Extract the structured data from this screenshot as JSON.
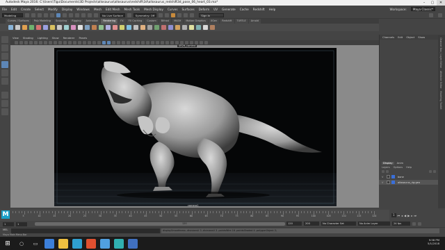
{
  "window": {
    "title": "Autodesk Maya 2016: C:\\Users\\Tigu\\Documents\\3D Projects\\allosaurus\\allosaurus\\redshift\\3d\\allosaurus_redshift3d_pose_06_heart_03.ma*",
    "controls": [
      "–",
      "▢",
      "✕"
    ]
  },
  "menubar": {
    "items": [
      "File",
      "Edit",
      "Create",
      "Select",
      "Modify",
      "Display",
      "Windows",
      "Mesh",
      "Edit Mesh",
      "Mesh Tools",
      "Mesh Display",
      "Curves",
      "Surfaces",
      "Deform",
      "UV",
      "Generate",
      "Cache",
      "Redshift",
      "Help"
    ],
    "workspace_label": "Workspace:",
    "workspace_value": "Maya Classic*"
  },
  "statusline": {
    "mode": "Modeling",
    "surface": "No Live Surface",
    "symmetry": "Symmetry: Off",
    "signin": "Sign In"
  },
  "shelf": {
    "tabs": [
      "Curves / Surfaces",
      "Poly Modeling",
      "Sculpting",
      "Rigging",
      "Animation",
      "Rendering",
      "FX",
      "FX Caching",
      "Custom",
      "Bifrost",
      "MASH",
      "Motion Graphics",
      "XGen",
      "Redshift",
      "TURTLE",
      "Arnold"
    ],
    "active": "Rendering",
    "icon_colors": [
      "#8ab4d8",
      "#c9c9c9",
      "#e0a050",
      "#6fb26f",
      "#d87070",
      "#9aa0e0",
      "#d8c060",
      "#c9c9c9",
      "#a0d0d0",
      "#d890c0",
      "#e0e0e0",
      "#7fa0c0",
      "#c08050",
      "#90c090",
      "#b0b0e0",
      "#e09090",
      "#d0d070",
      "#80c0e0",
      "#c0c0c0",
      "#e0b080",
      "#a0a0a0",
      "#70a070",
      "#c07070",
      "#9090d0",
      "#d0a060",
      "#b0b0b0",
      "#e0e0a0",
      "#80b0b0",
      "#d8d8d8",
      "#b08060"
    ]
  },
  "panel": {
    "menu": [
      "View",
      "Shading",
      "Lighting",
      "Show",
      "Renderer",
      "Panels"
    ],
    "camera_label": "SR2ft_camera",
    "camera_label_bottom": "camera1"
  },
  "channelbox": {
    "menu": [
      "Channels",
      "Edit",
      "Object",
      "Show"
    ],
    "side_tabs": [
      "Channel Box / Layer Editor",
      "Attribute Editor",
      "Modeling Toolkit"
    ]
  },
  "layereditor": {
    "tabs": [
      "Display",
      "Anim"
    ],
    "menu": [
      "Layers",
      "Options",
      "Help"
    ],
    "layers": [
      {
        "v": "V",
        "name": "bone"
      },
      {
        "v": "V",
        "name": "allosaurus_rig:geo"
      }
    ]
  },
  "timeslider": {
    "labels": [
      "5",
      "10",
      "15",
      "20",
      "25",
      "30",
      "35",
      "40",
      "45",
      "50",
      "55",
      "60",
      "65",
      "70",
      "75",
      "80",
      "85",
      "90",
      "95",
      "100",
      "105",
      "110",
      "115",
      "120"
    ],
    "current_frame": "1"
  },
  "rangeslider": {
    "start": "1",
    "start_inner": "1",
    "end_inner": "120",
    "end_anim": "120",
    "end_total": "200",
    "char_set": "No Character Set",
    "anim_layer": "No Anim Layer",
    "fps": "24 fps"
  },
  "cmdline": {
    "label": "MEL",
    "result": "displaySmoothness -divisionsU 3 -divisionsV 3 -pointsWire 16 -pointsShaded 4 -polygonObject 3;"
  },
  "helpline": {
    "text": "Maya Main Menu Bar"
  },
  "taskbar": {
    "time": "9:58 PM",
    "date": "5/1/2018",
    "app_colors": [
      "#3c7fd9",
      "#f0c040",
      "#2fa0d0",
      "#e05030",
      "#50a0e0",
      "#30b0b0",
      "#4070c0"
    ]
  },
  "colors": {
    "ui_bg": "#444444",
    "viewport_bg": "#050607",
    "selection_blue": "#5d86b6",
    "layer_blue": "#3a6fd8"
  }
}
